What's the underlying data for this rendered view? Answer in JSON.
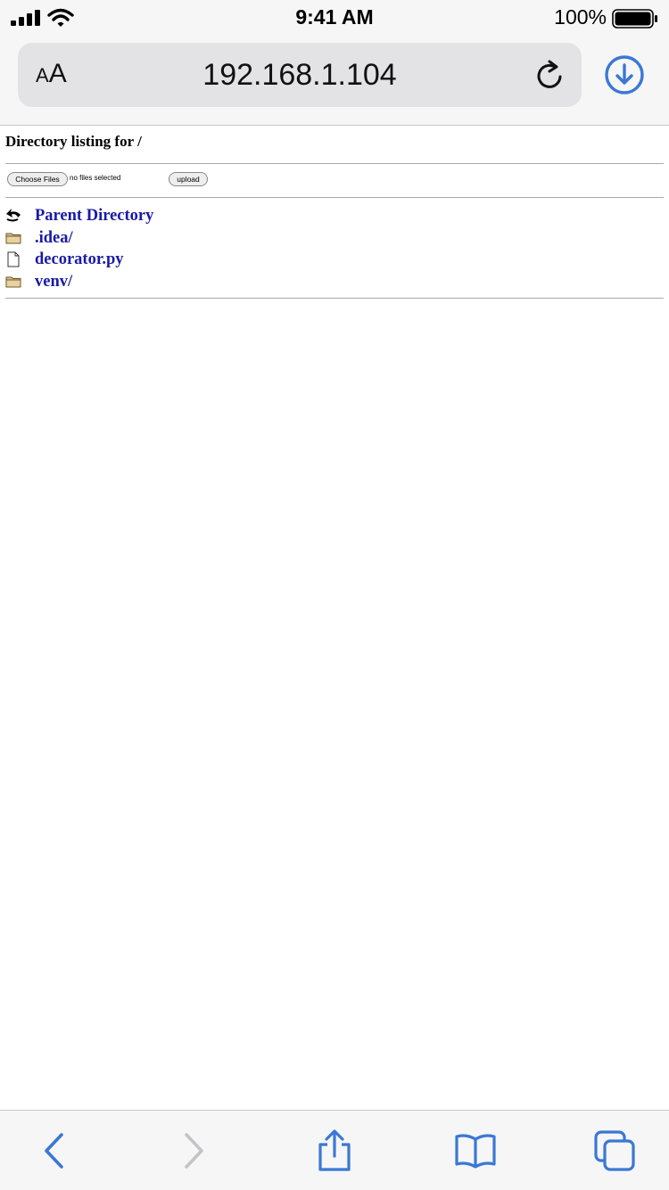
{
  "status_bar": {
    "time": "9:41 AM",
    "battery_percent": "100%",
    "battery_level": 1.0,
    "icons": [
      "cellular-signal-icon",
      "wifi-icon",
      "battery-icon"
    ]
  },
  "address_bar": {
    "text_size_button": {
      "small": "A",
      "large": "A"
    },
    "url": "192.168.1.104",
    "icons": [
      "reload-icon",
      "download-icon"
    ]
  },
  "page": {
    "title": "Directory listing for /",
    "upload": {
      "choose_files_label": "Choose Files",
      "file_status": "no files selected",
      "upload_label": "upload"
    },
    "entries": [
      {
        "name": "Parent Directory",
        "icon": "back-arrow-icon"
      },
      {
        "name": ".idea/",
        "icon": "folder-icon"
      },
      {
        "name": "decorator.py",
        "icon": "file-icon"
      },
      {
        "name": "venv/",
        "icon": "folder-icon"
      }
    ]
  },
  "toolbar": {
    "icons": [
      "back-icon",
      "forward-icon",
      "share-icon",
      "bookmarks-icon",
      "tabs-icon"
    ]
  },
  "colors": {
    "accent": "#3a78d4",
    "link": "#1a1aa6",
    "bar_background": "#f6f6f6"
  }
}
